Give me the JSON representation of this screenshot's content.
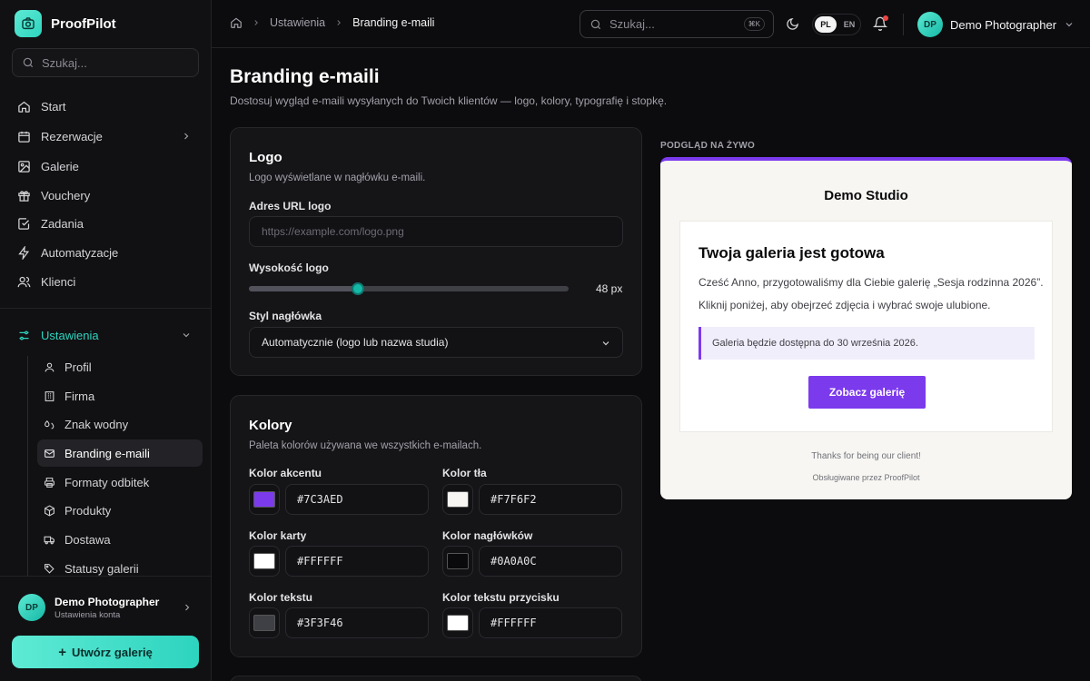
{
  "sidebar": {
    "brand": "ProofPilot",
    "search_placeholder": "Szukaj...",
    "items": [
      {
        "label": "Start",
        "icon": "home-icon"
      },
      {
        "label": "Rezerwacje",
        "icon": "calendar-icon"
      },
      {
        "label": "Galerie",
        "icon": "image-icon"
      },
      {
        "label": "Vouchery",
        "icon": "gift-icon"
      },
      {
        "label": "Zadania",
        "icon": "check-square-icon"
      },
      {
        "label": "Automatyzacje",
        "icon": "zap-icon"
      },
      {
        "label": "Klienci",
        "icon": "users-icon"
      }
    ],
    "settings_label": "Ustawienia",
    "sub_items": [
      {
        "label": "Profil"
      },
      {
        "label": "Firma"
      },
      {
        "label": "Znak wodny"
      },
      {
        "label": "Branding e-maili"
      },
      {
        "label": "Formaty odbitek"
      },
      {
        "label": "Produkty"
      },
      {
        "label": "Dostawa"
      },
      {
        "label": "Statusy galerii"
      }
    ],
    "user_name": "Demo Photographer",
    "user_sub": "Ustawienia konta",
    "user_initials": "DP",
    "create_label": "Utwórz galerię"
  },
  "topbar": {
    "crumb_1": "Ustawienia",
    "crumb_2": "Branding e-maili",
    "search_placeholder": "Szukaj...",
    "kbd": "⌘K",
    "lang_active": "PL",
    "lang_other": "EN",
    "user_name": "Demo Photographer",
    "user_initials": "DP"
  },
  "page": {
    "title": "Branding e-maili",
    "subtitle": "Dostosuj wygląd e-maili wysyłanych do Twoich klientów — logo, kolory, typografię i stopkę."
  },
  "logo_card": {
    "title": "Logo",
    "desc": "Logo wyświetlane w nagłówku e-maili.",
    "url_label": "Adres URL logo",
    "url_placeholder": "https://example.com/logo.png",
    "height_label": "Wysokość logo",
    "height_value": "48 px",
    "height_fraction": 0.34,
    "style_label": "Styl nagłówka",
    "style_value": "Automatycznie (logo lub nazwa studia)"
  },
  "colors_card": {
    "title": "Kolory",
    "desc": "Paleta kolorów używana we wszystkich e-mailach.",
    "fields": [
      {
        "label": "Kolor akcentu",
        "hex": "#7C3AED"
      },
      {
        "label": "Kolor tła",
        "hex": "#F7F6F2"
      },
      {
        "label": "Kolor karty",
        "hex": "#FFFFFF"
      },
      {
        "label": "Kolor nagłówków",
        "hex": "#0A0A0C"
      },
      {
        "label": "Kolor tekstu",
        "hex": "#3F3F46"
      },
      {
        "label": "Kolor tekstu przycisku",
        "hex": "#FFFFFF"
      }
    ]
  },
  "preview": {
    "label": "PODGLĄD NA ŻYWO",
    "studio": "Demo Studio",
    "heading": "Twoja galeria jest gotowa",
    "para_1": "Cześć Anno, przygotowaliśmy dla Ciebie galerię „Sesja rodzinna 2026”.",
    "para_2": "Kliknij poniżej, aby obejrzeć zdjęcia i wybrać swoje ulubione.",
    "note": "Galeria będzie dostępna do 30 września 2026.",
    "button": "Zobacz galerię",
    "footer_1": "Thanks for being our client!",
    "footer_2": "Obsługiwane przez ProofPilot"
  },
  "colors": {
    "accent_teal": "#2dd4bf",
    "email_accent": "#7C3AED"
  }
}
